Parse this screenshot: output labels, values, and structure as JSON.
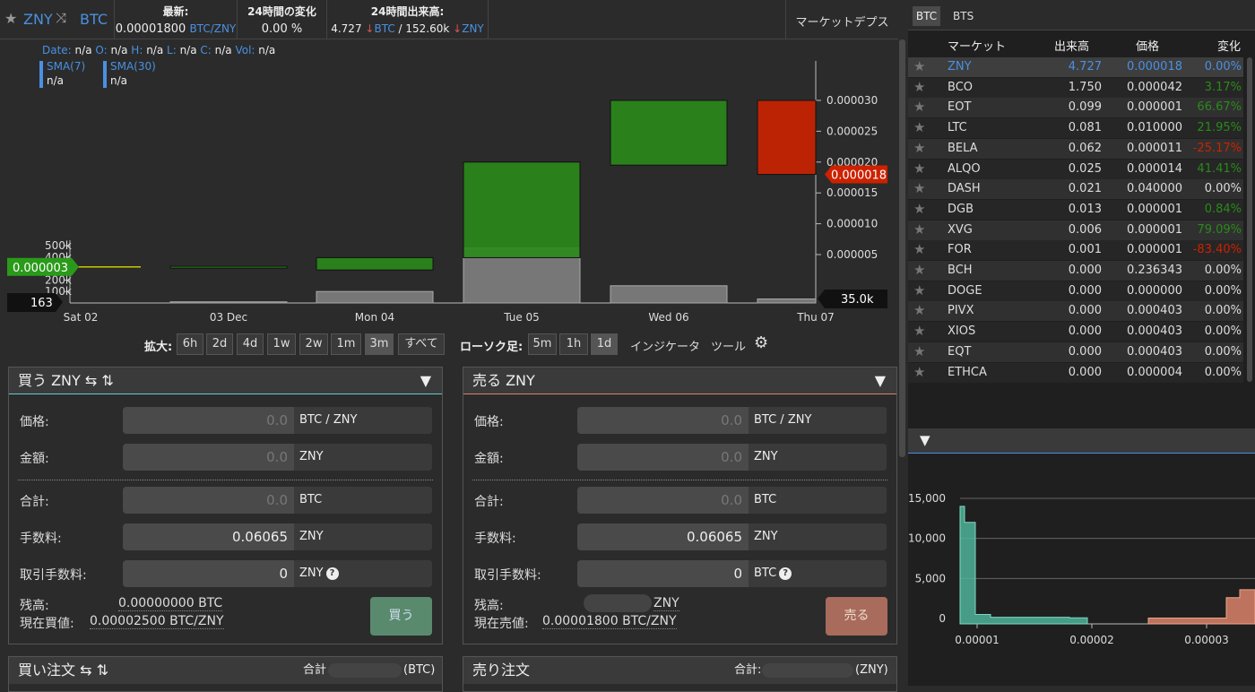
{
  "header": {
    "base": "ZNY",
    "quote": "BTC",
    "latest_label": "最新:",
    "latest_value": "0.00001800",
    "latest_unit": "BTC/ZNY",
    "change_label": "24時間の変化",
    "change_value": "0.00 %",
    "volume_label": "24時間出来高:",
    "volume_value1": "4.727",
    "volume_unit1": "BTC",
    "volume_sep": "/ 152.60k",
    "volume_unit2": "ZNY",
    "depth_tab": "マーケットデプス"
  },
  "chart_info": {
    "ohlc_line": [
      {
        "label": "Date:",
        "value": "n/a"
      },
      {
        "label": "O:",
        "value": "n/a"
      },
      {
        "label": "H:",
        "value": "n/a"
      },
      {
        "label": "L:",
        "value": "n/a"
      },
      {
        "label": "C:",
        "value": "n/a"
      },
      {
        "label": "Vol:",
        "value": "n/a"
      }
    ],
    "sma7_label": "SMA(7)",
    "sma7_value": "n/a",
    "sma30_label": "SMA(30)",
    "sma30_value": "n/a"
  },
  "chart_data": {
    "type": "candlestick",
    "x": [
      "Sat 02",
      "03 Dec",
      "Mon 04",
      "Tue 05",
      "Wed 06",
      "Thu 07"
    ],
    "price_ticks": [
      "0.000030",
      "0.000025",
      "0.000020",
      "0.000015",
      "0.000010",
      "0.000005"
    ],
    "volume_ticks": [
      "500k",
      "400k",
      "300k",
      "200k",
      "100k"
    ],
    "candles": [
      {
        "x": "Sat 02",
        "open": 3e-06,
        "close": 3e-06,
        "color": "#c8c800"
      },
      {
        "x": "03 Dec",
        "open": 2.8e-06,
        "close": 3.1e-06,
        "color": "#2a8a1a"
      },
      {
        "x": "Mon 04",
        "open": 2.5e-06,
        "close": 4.5e-06,
        "color": "#2a8a1a"
      },
      {
        "x": "Tue 05",
        "open": 4.5e-06,
        "close": 2e-05,
        "color": "#2a8a1a"
      },
      {
        "x": "Wed 06",
        "open": 1.95e-05,
        "close": 3e-05,
        "color": "#2a8a1a"
      },
      {
        "x": "Thu 07",
        "open": 3e-05,
        "close": 1.8e-05,
        "color": "#cc2200"
      }
    ],
    "volumes": [
      0,
      10000,
      100000,
      480000,
      150000,
      35000
    ],
    "left_price_label": "0.000003",
    "left_volume_label": "163",
    "right_price_label": "0.000018",
    "right_volume_label": "35.0k"
  },
  "controls": {
    "zoom_label": "拡大:",
    "zoom_options": [
      "6h",
      "2d",
      "4d",
      "1w",
      "2w",
      "1m",
      "3m",
      "すべて"
    ],
    "zoom_active": "3m",
    "candle_label": "ローソク足:",
    "candle_options": [
      "5m",
      "1h",
      "1d"
    ],
    "candle_active": "1d",
    "indicator": "インジケータ",
    "tools": "ツール"
  },
  "buy": {
    "title": "買う ZNY ⇆ ⇅",
    "price_label": "価格:",
    "price_value": "0.0",
    "price_unit": "BTC / ZNY",
    "amount_label": "金額:",
    "amount_value": "0.0",
    "amount_unit": "ZNY",
    "total_label": "合計:",
    "total_value": "0.0",
    "total_unit": "BTC",
    "fee_label": "手数料:",
    "fee_value": "0.06065",
    "fee_unit": "ZNY",
    "tfee_label": "取引手数料:",
    "tfee_value": "0",
    "tfee_unit": "ZNY",
    "balance_label": "残高:",
    "balance_value": "0.00000000 BTC",
    "current_label": "現在買値:",
    "current_value": "0.00002500 BTC/ZNY",
    "button": "買う"
  },
  "sell": {
    "title": "売る ZNY",
    "price_label": "価格:",
    "price_value": "0.0",
    "price_unit": "BTC / ZNY",
    "amount_label": "金額:",
    "amount_value": "0.0",
    "amount_unit": "ZNY",
    "total_label": "合計:",
    "total_value": "0.0",
    "total_unit": "BTC",
    "fee_label": "手数料:",
    "fee_value": "0.06065",
    "fee_unit": "ZNY",
    "tfee_label": "取引手数料:",
    "tfee_value": "0",
    "tfee_unit": "BTC",
    "balance_label": "残高:",
    "balance_unit": "ZNY",
    "current_label": "現在売値:",
    "current_value": "0.00001800 BTC/ZNY",
    "button": "売る"
  },
  "orders": {
    "buy_title": "買い注文 ⇆ ⇅",
    "buy_total": "合計",
    "buy_unit": "(BTC)",
    "sell_title": "売り注文",
    "sell_total": "合計:",
    "sell_unit": "(ZNY)"
  },
  "markets": {
    "tabs": [
      "BTC",
      "BTS"
    ],
    "headers": [
      "マーケット",
      "出来高",
      "価格",
      "変化"
    ],
    "rows": [
      {
        "name": "ZNY",
        "vol": "4.727",
        "price": "0.000018",
        "change": "0.00%",
        "dir": "sel"
      },
      {
        "name": "BCO",
        "vol": "1.750",
        "price": "0.000042",
        "change": "3.17%",
        "dir": "up"
      },
      {
        "name": "EOT",
        "vol": "0.099",
        "price": "0.000001",
        "change": "66.67%",
        "dir": "up"
      },
      {
        "name": "LTC",
        "vol": "0.081",
        "price": "0.010000",
        "change": "21.95%",
        "dir": "up"
      },
      {
        "name": "BELA",
        "vol": "0.062",
        "price": "0.000011",
        "change": "-25.17%",
        "dir": "down"
      },
      {
        "name": "ALQO",
        "vol": "0.025",
        "price": "0.000014",
        "change": "41.41%",
        "dir": "up"
      },
      {
        "name": "DASH",
        "vol": "0.021",
        "price": "0.040000",
        "change": "0.00%",
        "dir": "flat"
      },
      {
        "name": "DGB",
        "vol": "0.013",
        "price": "0.000001",
        "change": "0.84%",
        "dir": "up"
      },
      {
        "name": "XVG",
        "vol": "0.006",
        "price": "0.000001",
        "change": "79.09%",
        "dir": "up"
      },
      {
        "name": "FOR",
        "vol": "0.001",
        "price": "0.000001",
        "change": "-83.40%",
        "dir": "down"
      },
      {
        "name": "BCH",
        "vol": "0.000",
        "price": "0.236343",
        "change": "0.00%",
        "dir": "flat"
      },
      {
        "name": "DOGE",
        "vol": "0.000",
        "price": "0.000000",
        "change": "0.00%",
        "dir": "flat"
      },
      {
        "name": "PIVX",
        "vol": "0.000",
        "price": "0.000403",
        "change": "0.00%",
        "dir": "flat"
      },
      {
        "name": "XIOS",
        "vol": "0.000",
        "price": "0.000403",
        "change": "0.00%",
        "dir": "flat"
      },
      {
        "name": "EQT",
        "vol": "0.000",
        "price": "0.000403",
        "change": "0.00%",
        "dir": "flat"
      },
      {
        "name": "ETHCA",
        "vol": "0.000",
        "price": "0.000004",
        "change": "0.00%",
        "dir": "flat"
      }
    ]
  },
  "depth": {
    "y_ticks": [
      "15,000",
      "10,000",
      "5,000",
      "0"
    ],
    "x_ticks": [
      "0.00001",
      "0.00002",
      "0.00003"
    ]
  },
  "colors": {
    "green": "#2a8a1a",
    "red": "#cc2200",
    "blue": "#4a90e2",
    "teal": "#4fb39a",
    "salmon": "#d9826a"
  }
}
